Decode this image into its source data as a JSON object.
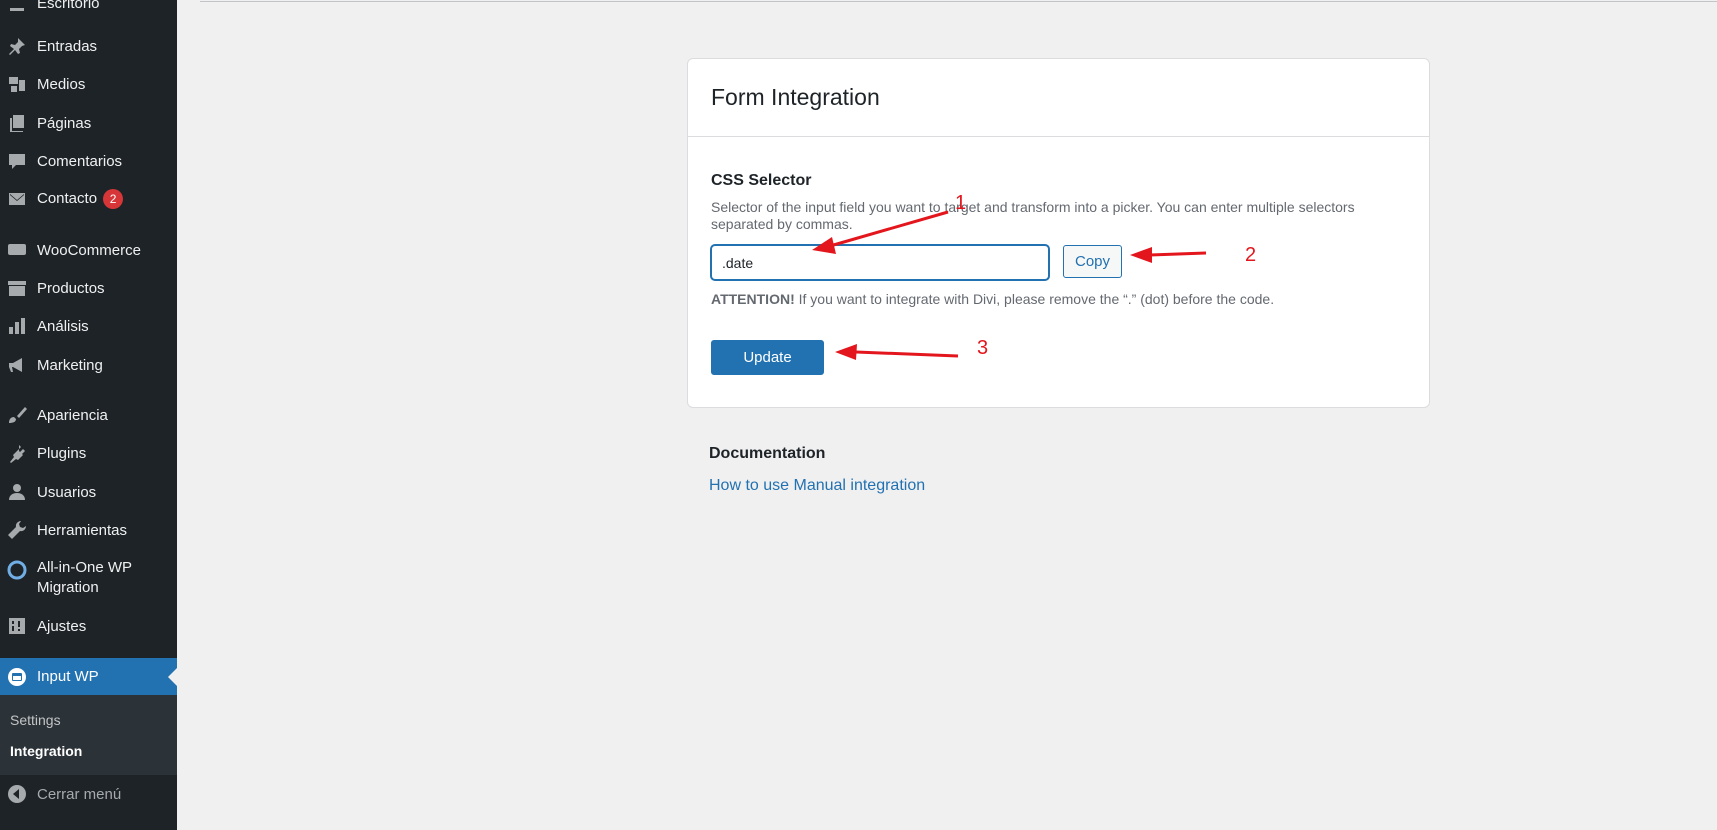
{
  "sidebar": {
    "top_partial": "Escritorio",
    "items": [
      {
        "label": "Entradas",
        "icon": "pin-icon"
      },
      {
        "label": "Medios",
        "icon": "media-icon"
      },
      {
        "label": "Páginas",
        "icon": "pages-icon"
      },
      {
        "label": "Comentarios",
        "icon": "comments-icon"
      },
      {
        "label": "Contacto",
        "icon": "mail-icon",
        "badge": "2"
      },
      {
        "label": "WooCommerce",
        "icon": "woo-icon"
      },
      {
        "label": "Productos",
        "icon": "archive-icon"
      },
      {
        "label": "Análisis",
        "icon": "chart-icon"
      },
      {
        "label": "Marketing",
        "icon": "megaphone-icon"
      },
      {
        "label": "Apariencia",
        "icon": "brush-icon"
      },
      {
        "label": "Plugins",
        "icon": "plug-icon"
      },
      {
        "label": "Usuarios",
        "icon": "user-icon"
      },
      {
        "label": "Herramientas",
        "icon": "wrench-icon"
      },
      {
        "label": "All-in-One WP Migration",
        "icon": "migration-icon"
      },
      {
        "label": "Ajustes",
        "icon": "settings-icon"
      }
    ],
    "active_item": {
      "label": "Input WP",
      "icon": "calendar-icon"
    },
    "submenu": [
      {
        "label": "Settings"
      },
      {
        "label": "Integration"
      }
    ],
    "collapse_label": "Cerrar menú",
    "colors": {
      "bg": "#1d2327",
      "active": "#2271b1",
      "badge": "#d63638"
    }
  },
  "card": {
    "title": "Form Integration",
    "field_label": "CSS Selector",
    "field_description": "Selector of the input field you want to target and transform into a picker. You can enter multiple selectors separated by commas.",
    "input_value": ".date",
    "copy_label": "Copy",
    "attention_strong": "ATTENTION!",
    "attention_text": " If you want to integrate with Divi, please remove the “.” (dot) before the code.",
    "update_label": "Update"
  },
  "documentation": {
    "title": "Documentation",
    "link_text": "How to use Manual integration"
  },
  "annotations": {
    "numbers": [
      "1",
      "2",
      "3"
    ],
    "color": "#e4161d"
  }
}
